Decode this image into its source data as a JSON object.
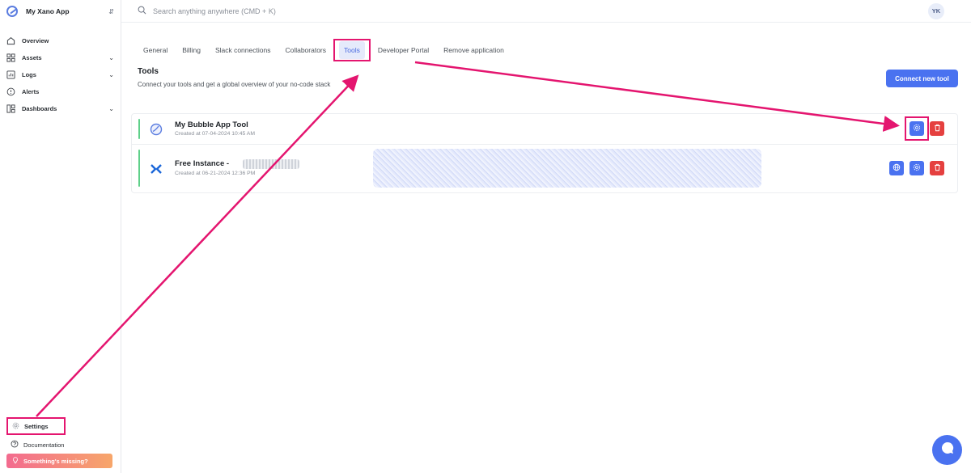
{
  "app": {
    "name": "My Xano App"
  },
  "sidebar": {
    "items": [
      {
        "label": "Overview",
        "icon": "home-icon",
        "expandable": false
      },
      {
        "label": "Assets",
        "icon": "grid-icon",
        "expandable": true
      },
      {
        "label": "Logs",
        "icon": "logs-icon",
        "expandable": true
      },
      {
        "label": "Alerts",
        "icon": "alert-icon",
        "expandable": false
      },
      {
        "label": "Dashboards",
        "icon": "dashboard-icon",
        "expandable": true
      }
    ],
    "settings_label": "Settings",
    "documentation_label": "Documentation",
    "missing_label": "Something's missing?"
  },
  "search": {
    "placeholder": "Search anything anywhere (CMD + K)"
  },
  "user": {
    "initials": "YK"
  },
  "tabs": [
    {
      "label": "General",
      "active": false
    },
    {
      "label": "Billing",
      "active": false
    },
    {
      "label": "Slack connections",
      "active": false
    },
    {
      "label": "Collaborators",
      "active": false
    },
    {
      "label": "Tools",
      "active": true
    },
    {
      "label": "Developer Portal",
      "active": false
    },
    {
      "label": "Remove application",
      "active": false
    }
  ],
  "page": {
    "title": "Tools",
    "subtitle": "Connect your tools and get a global overview of your no-code stack",
    "connect_button": "Connect new tool"
  },
  "tools": [
    {
      "name": "My Bubble App Tool",
      "created": "Created at 07-04-2024 10:45 AM",
      "icon": "bubble-icon"
    },
    {
      "name": "Free Instance -",
      "created": "Created at 06-21-2024 12:36 PM",
      "icon": "xano-icon"
    }
  ],
  "colors": {
    "accent": "#4a72f0",
    "danger": "#e5403f",
    "highlight": "#e4156f",
    "status": "#5fd08a"
  }
}
